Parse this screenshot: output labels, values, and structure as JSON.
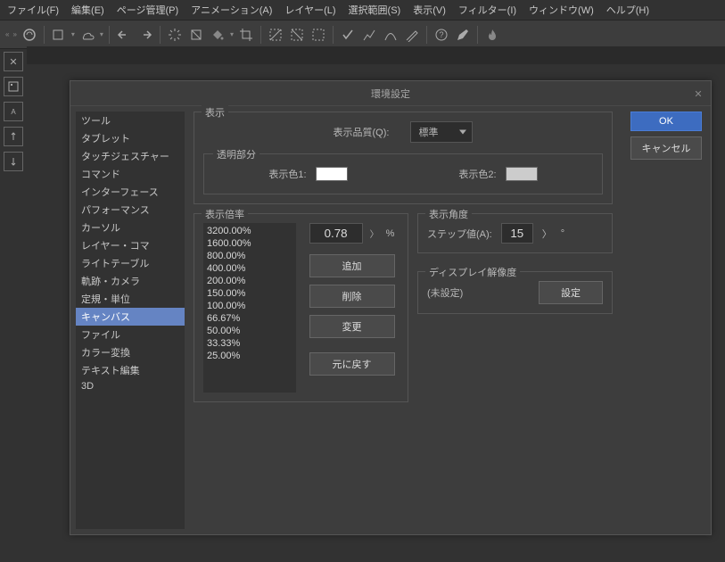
{
  "menubar": [
    "ファイル(F)",
    "編集(E)",
    "ページ管理(P)",
    "アニメーション(A)",
    "レイヤー(L)",
    "選択範囲(S)",
    "表示(V)",
    "フィルター(I)",
    "ウィンドウ(W)",
    "ヘルプ(H)"
  ],
  "dialog": {
    "title": "環境設定",
    "ok": "OK",
    "cancel": "キャンセル",
    "categories": [
      "ツール",
      "タブレット",
      "タッチジェスチャー",
      "コマンド",
      "インターフェース",
      "パフォーマンス",
      "カーソル",
      "レイヤー・コマ",
      "ライトテーブル",
      "軌跡・カメラ",
      "定規・単位",
      "キャンバス",
      "ファイル",
      "カラー変換",
      "テキスト編集",
      "3D"
    ],
    "selected_index": 11,
    "display_group": {
      "legend": "表示",
      "quality_label": "表示品質(Q):",
      "quality_value": "標準",
      "transparency_legend": "透明部分",
      "color1_label": "表示色1:",
      "color1": "#ffffff",
      "color2_label": "表示色2:",
      "color2": "#cccccc"
    },
    "zoom_group": {
      "legend": "表示倍率",
      "levels": [
        "3200.00%",
        "1600.00%",
        "800.00%",
        "400.00%",
        "200.00%",
        "150.00%",
        "100.00%",
        "66.67%",
        "50.00%",
        "33.33%",
        "25.00%"
      ],
      "input_value": "0.78",
      "suffix": "%",
      "add": "追加",
      "delete": "削除",
      "change": "変更",
      "reset": "元に戻す"
    },
    "angle_group": {
      "legend": "表示角度",
      "step_label": "ステップ値(A):",
      "step_value": "15",
      "suffix": "°"
    },
    "resolution_group": {
      "legend": "ディスプレイ解像度",
      "status": "(未設定)",
      "set_btn": "設定"
    }
  }
}
